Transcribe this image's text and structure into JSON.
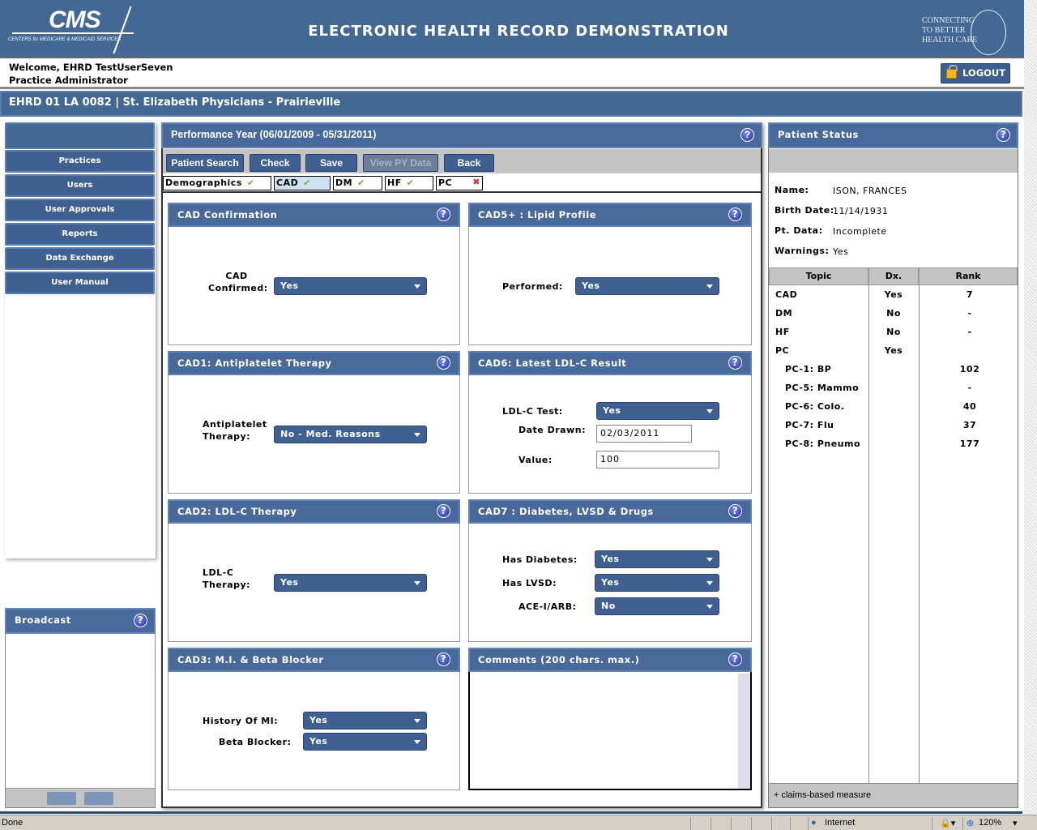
{
  "header": {
    "logo_text": "CMS",
    "logo_subtext": "CENTERS for MEDICARE & MEDICAID SERVICES",
    "title": "ELECTRONIC HEALTH RECORD DEMONSTRATION",
    "hhs_lines": [
      "CONNECTING",
      "TO BETTER",
      "HEALTH CARE"
    ]
  },
  "user": {
    "welcome": "Welcome, EHRD TestUserSeven",
    "role": "Practice Administrator",
    "logout": "LOGOUT"
  },
  "practice": "EHRD 01 LA 0082 | St. Elizabeth Physicians - Prairieville",
  "nav": [
    "Practices",
    "Users",
    "User Approvals",
    "Reports",
    "Data Exchange",
    "User Manual"
  ],
  "broadcast": {
    "title": "Broadcast"
  },
  "form": {
    "title": "Performance Year (06/01/2009 - 05/31/2011)",
    "toolbar": [
      "Patient Search",
      "Check",
      "Save",
      "View PY Data",
      "Back"
    ],
    "tabs": [
      "Demographics",
      "CAD",
      "DM",
      "HF",
      "PC"
    ],
    "panels": {
      "cad_confirm": {
        "title": "CAD Confirmation",
        "label": "CAD Confirmed:",
        "label1": "CAD",
        "label2": "Confirmed:",
        "value": "Yes"
      },
      "cad5": {
        "title": "CAD5+ : Lipid Profile",
        "label": "Performed:",
        "value": "Yes"
      },
      "cad1": {
        "title": "CAD1: Antiplatelet Therapy",
        "label1": "Antiplatelet",
        "label2": "Therapy:",
        "value": "No - Med. Reasons"
      },
      "cad6": {
        "title": "CAD6: Latest LDL-C Result",
        "test_label": "LDL-C Test:",
        "test_value": "Yes",
        "date_label": "Date Drawn:",
        "date_value": "02/03/2011",
        "value_label": "Value:",
        "value": "100"
      },
      "cad2": {
        "title": "CAD2: LDL-C Therapy",
        "label1": "LDL-C",
        "label2": "Therapy:",
        "value": "Yes"
      },
      "cad7": {
        "title": "CAD7 : Diabetes, LVSD & Drugs",
        "diab_label": "Has Diabetes:",
        "diab_value": "Yes",
        "lvsd_label": "Has LVSD:",
        "lvsd_value": "Yes",
        "ace_label": "ACE-I/ARB:",
        "ace_value": "No"
      },
      "cad3": {
        "title": "CAD3: M.I. & Beta Blocker",
        "mi_label": "History Of MI:",
        "mi_value": "Yes",
        "bb_label": "Beta Blocker:",
        "bb_value": "Yes"
      },
      "comments": {
        "title": "Comments (200 chars. max.)",
        "value": ""
      }
    }
  },
  "patient": {
    "title": "Patient Status",
    "name_label": "Name:",
    "name": "ISON, FRANCES",
    "dob_label": "Birth Date:",
    "dob": "11/14/1931",
    "data_label": "Pt. Data:",
    "data": "Incomplete",
    "warn_label": "Warnings:",
    "warn": "Yes",
    "columns": [
      "Topic",
      "Dx.",
      "Rank"
    ],
    "rows": [
      [
        "CAD",
        "Yes",
        "7"
      ],
      [
        "DM",
        "No",
        "-"
      ],
      [
        "HF",
        "No",
        "-"
      ],
      [
        "PC",
        "Yes",
        ""
      ],
      [
        "PC-1: BP",
        "",
        "102"
      ],
      [
        "PC-5: Mammo",
        "",
        "-"
      ],
      [
        "PC-6: Colo.",
        "",
        "40"
      ],
      [
        "PC-7: Flu",
        "",
        "37"
      ],
      [
        "PC-8: Pneumo",
        "",
        "177"
      ]
    ],
    "footer": "+ claims-based measure"
  },
  "statusbar": {
    "left": "Done",
    "zone": "Internet",
    "zoom": "120%"
  }
}
